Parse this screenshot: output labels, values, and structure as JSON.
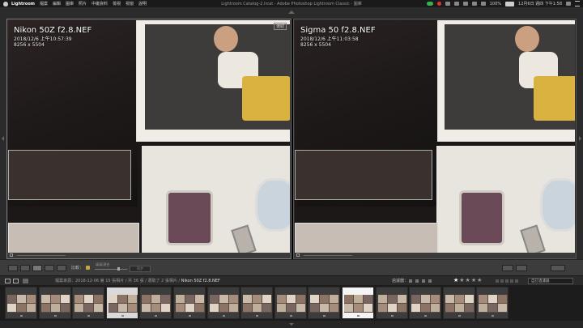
{
  "menubar": {
    "app": "Lightroom",
    "items": [
      "檔案",
      "編輯",
      "圖庫",
      "照片",
      "中繼資料",
      "檢視",
      "視窗",
      "說明"
    ],
    "window_title": "Lightroom Catalog-2.lrcat - Adobe Photoshop Lightroom Classic - 圖庫",
    "battery": "100%",
    "clock": "12月6日 週四 下午1:58"
  },
  "compare": {
    "select": {
      "filename": "Nikon 50Z f2.8.NEF",
      "datetime": "2018/12/6 上午10:57:39",
      "dimensions": "8256 x 5504",
      "badge": "選取"
    },
    "candidate": {
      "filename": "Sigma 50 f2.8.NEF",
      "datetime": "2018/12/6 上午11:03:58",
      "dimensions": "8256 x 5504"
    }
  },
  "toolbar": {
    "compare_label": "比較：",
    "zoom_label": "填滿/適合",
    "sync_label": "同步"
  },
  "filmstrip_bar": {
    "source": "檔案來源：2018-12-06",
    "count": "第 15 張相片 / 共 36 張 / 選取了 2 張相片 /",
    "current": "Nikon 50Z f2.8.NEF",
    "filter_label": "過濾器：",
    "rating_stars": 1,
    "filter_select": "自訂過濾器"
  },
  "filmstrip": {
    "thumb_count": 15,
    "selected_indices": [
      3,
      10
    ],
    "active_index": 10
  }
}
